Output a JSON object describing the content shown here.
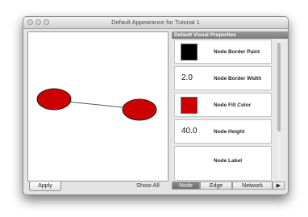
{
  "window": {
    "title": "Default Appearance for Tutorial 1"
  },
  "canvas": {
    "node_color": "#cc0000",
    "edge_color": "#555555"
  },
  "buttons": {
    "apply": "Apply",
    "show_all": "Show All"
  },
  "panel": {
    "header": "Default Visual Properties",
    "properties": [
      {
        "label": "Node Border Paint",
        "kind": "swatch",
        "color": "#000000"
      },
      {
        "label": "Node Border Width",
        "kind": "value",
        "value": "2.0"
      },
      {
        "label": "Node Fill Color",
        "kind": "swatch",
        "color": "#cc0000"
      },
      {
        "label": "Node Height",
        "kind": "value",
        "value": "40.0"
      },
      {
        "label": "Node Label",
        "kind": "empty"
      }
    ]
  },
  "tabs": [
    "Node",
    "Edge",
    "Network"
  ],
  "tab_overflow_icon": "triangle-right-icon"
}
